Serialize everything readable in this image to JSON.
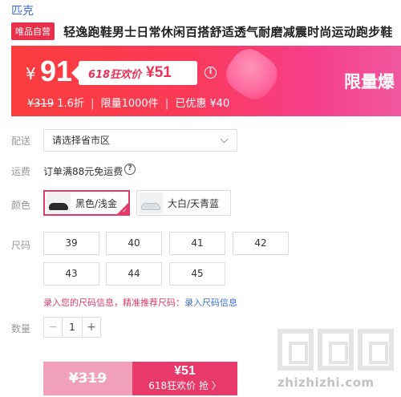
{
  "brand": "匹克",
  "product": {
    "badge": "唯品自营",
    "title": "轻逸跑鞋男士日常休闲百搭舒适透气耐磨减震时尚运动跑步鞋"
  },
  "promo": {
    "currency": "¥",
    "price": "91",
    "event_label": "618狂欢价",
    "event_price": "¥51",
    "info_icon": "info-icon",
    "limited_text": "限量爆",
    "original_price": "¥319",
    "discount": "1.6折",
    "limited_qty": "限量1000件",
    "saved": "已优惠 ¥40",
    "separator": "|"
  },
  "delivery": {
    "label": "配送",
    "placeholder": "请选择省市区"
  },
  "shipping": {
    "label": "运费",
    "text": "订单满88元免运费",
    "icon": "help-icon"
  },
  "color": {
    "label": "颜色",
    "options": [
      {
        "label": "黑色/浅金",
        "selected": true
      },
      {
        "label": "大白/天青蓝",
        "selected": false
      }
    ]
  },
  "size": {
    "label": "尺码",
    "options": [
      "39",
      "40",
      "41",
      "42",
      "43",
      "44",
      "45"
    ],
    "hint": "录入您的尺码信息，精准推荐尺码：",
    "hint_link": "录入尺码信息"
  },
  "quantity": {
    "label": "数量",
    "minus": "−",
    "value": "1",
    "plus": "+"
  },
  "buy": {
    "original_price": "¥319",
    "sale_price": "¥51",
    "sale_label": "618狂欢价 抢 〉"
  },
  "watermark": {
    "text": "zhizhizhi.com",
    "logo": "值值值"
  },
  "colors": {
    "accent": "#e33b67",
    "brand_link": "#3b6fd8",
    "banner_start": "#fb3d3c",
    "banner_end": "#f0579e"
  }
}
